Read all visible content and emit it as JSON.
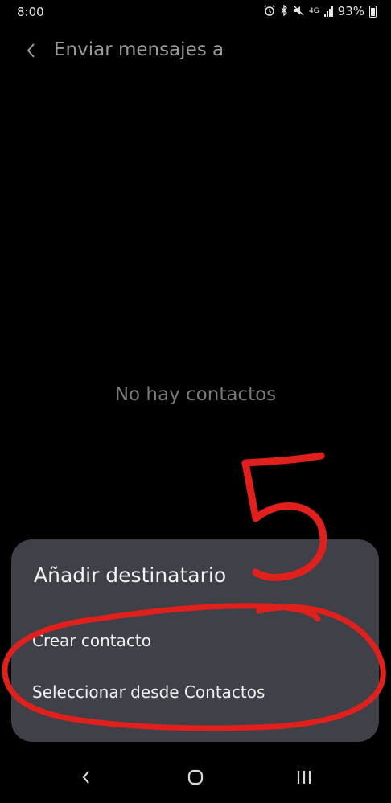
{
  "status_bar": {
    "time": "8:00",
    "network": "4G",
    "battery_pct": "93%",
    "icons": [
      "alarm-icon",
      "bluetooth-icon",
      "mute-icon",
      "network-4g-icon",
      "signal-icon",
      "battery-icon"
    ]
  },
  "header": {
    "back_icon": "chevron-left-icon",
    "title": "Enviar mensajes a"
  },
  "main": {
    "empty_text": "No hay contactos"
  },
  "sheet": {
    "title": "Añadir destinatario",
    "options": [
      "Crear contacto",
      "Seleccionar desde Contactos"
    ]
  },
  "annotation": {
    "number": "5",
    "color": "#e0201c"
  },
  "nav_bar": {
    "icons": [
      "back-icon",
      "home-icon",
      "recents-icon"
    ]
  },
  "colors": {
    "background": "#000000",
    "sheet": "#3f4048",
    "header_text": "#9a9a9a",
    "empty_text": "#7a7a7a"
  }
}
